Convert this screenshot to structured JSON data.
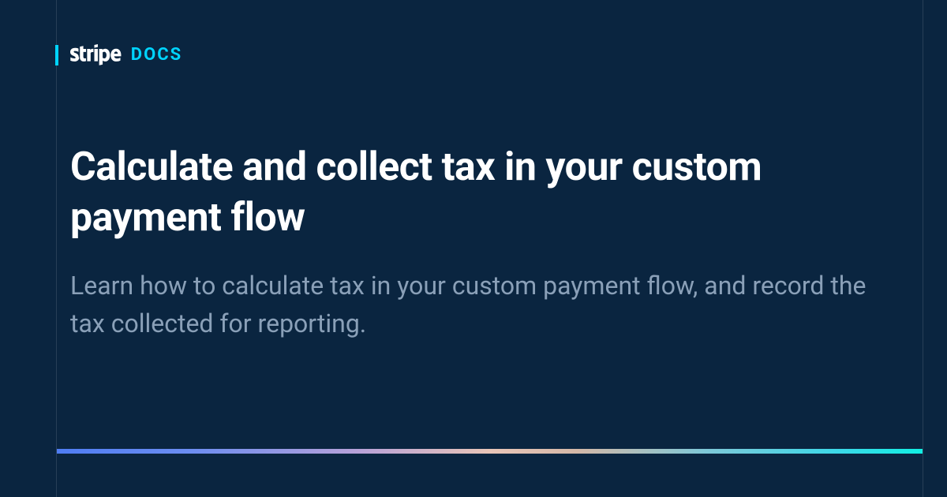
{
  "header": {
    "brand": "stripe",
    "section": "DOCS"
  },
  "content": {
    "title": "Calculate and collect tax in your custom payment flow",
    "subtitle": "Learn how to calculate tax in your custom payment flow, and record the tax collected for reporting."
  }
}
